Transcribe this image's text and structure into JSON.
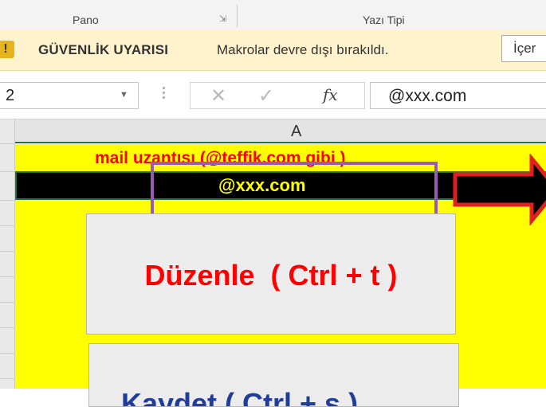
{
  "ribbon": {
    "pano_label": "Pano",
    "yazi_tipi_label": "Yazı Tipi"
  },
  "security_bar": {
    "title": "GÜVENLİK UYARISI",
    "message": "Makrolar devre dışı bırakıldı.",
    "button_label": "İçer",
    "icon": "warning-shield-icon",
    "background_color": "#fff3cd"
  },
  "formula_bar": {
    "name_box_value": "2",
    "cancel_icon": "✕",
    "enter_icon": "✓",
    "fx_label": "fx",
    "formula_value": "@xxx.com"
  },
  "grid": {
    "column_header": "A"
  },
  "sheet": {
    "label_text": "mail uzantısı (@teffik.com gibi )",
    "value_text": "@xxx.com",
    "background_color": "#ffff00",
    "label_color": "#ff0000",
    "value_color": "#ffff00",
    "highlight_color": "#9b59b6",
    "arrow_color": "#e02020"
  },
  "buttons": {
    "edit_label": "Düzenle  ( Ctrl + t )",
    "save_label": "Kaydet ( Ctrl + s )"
  }
}
